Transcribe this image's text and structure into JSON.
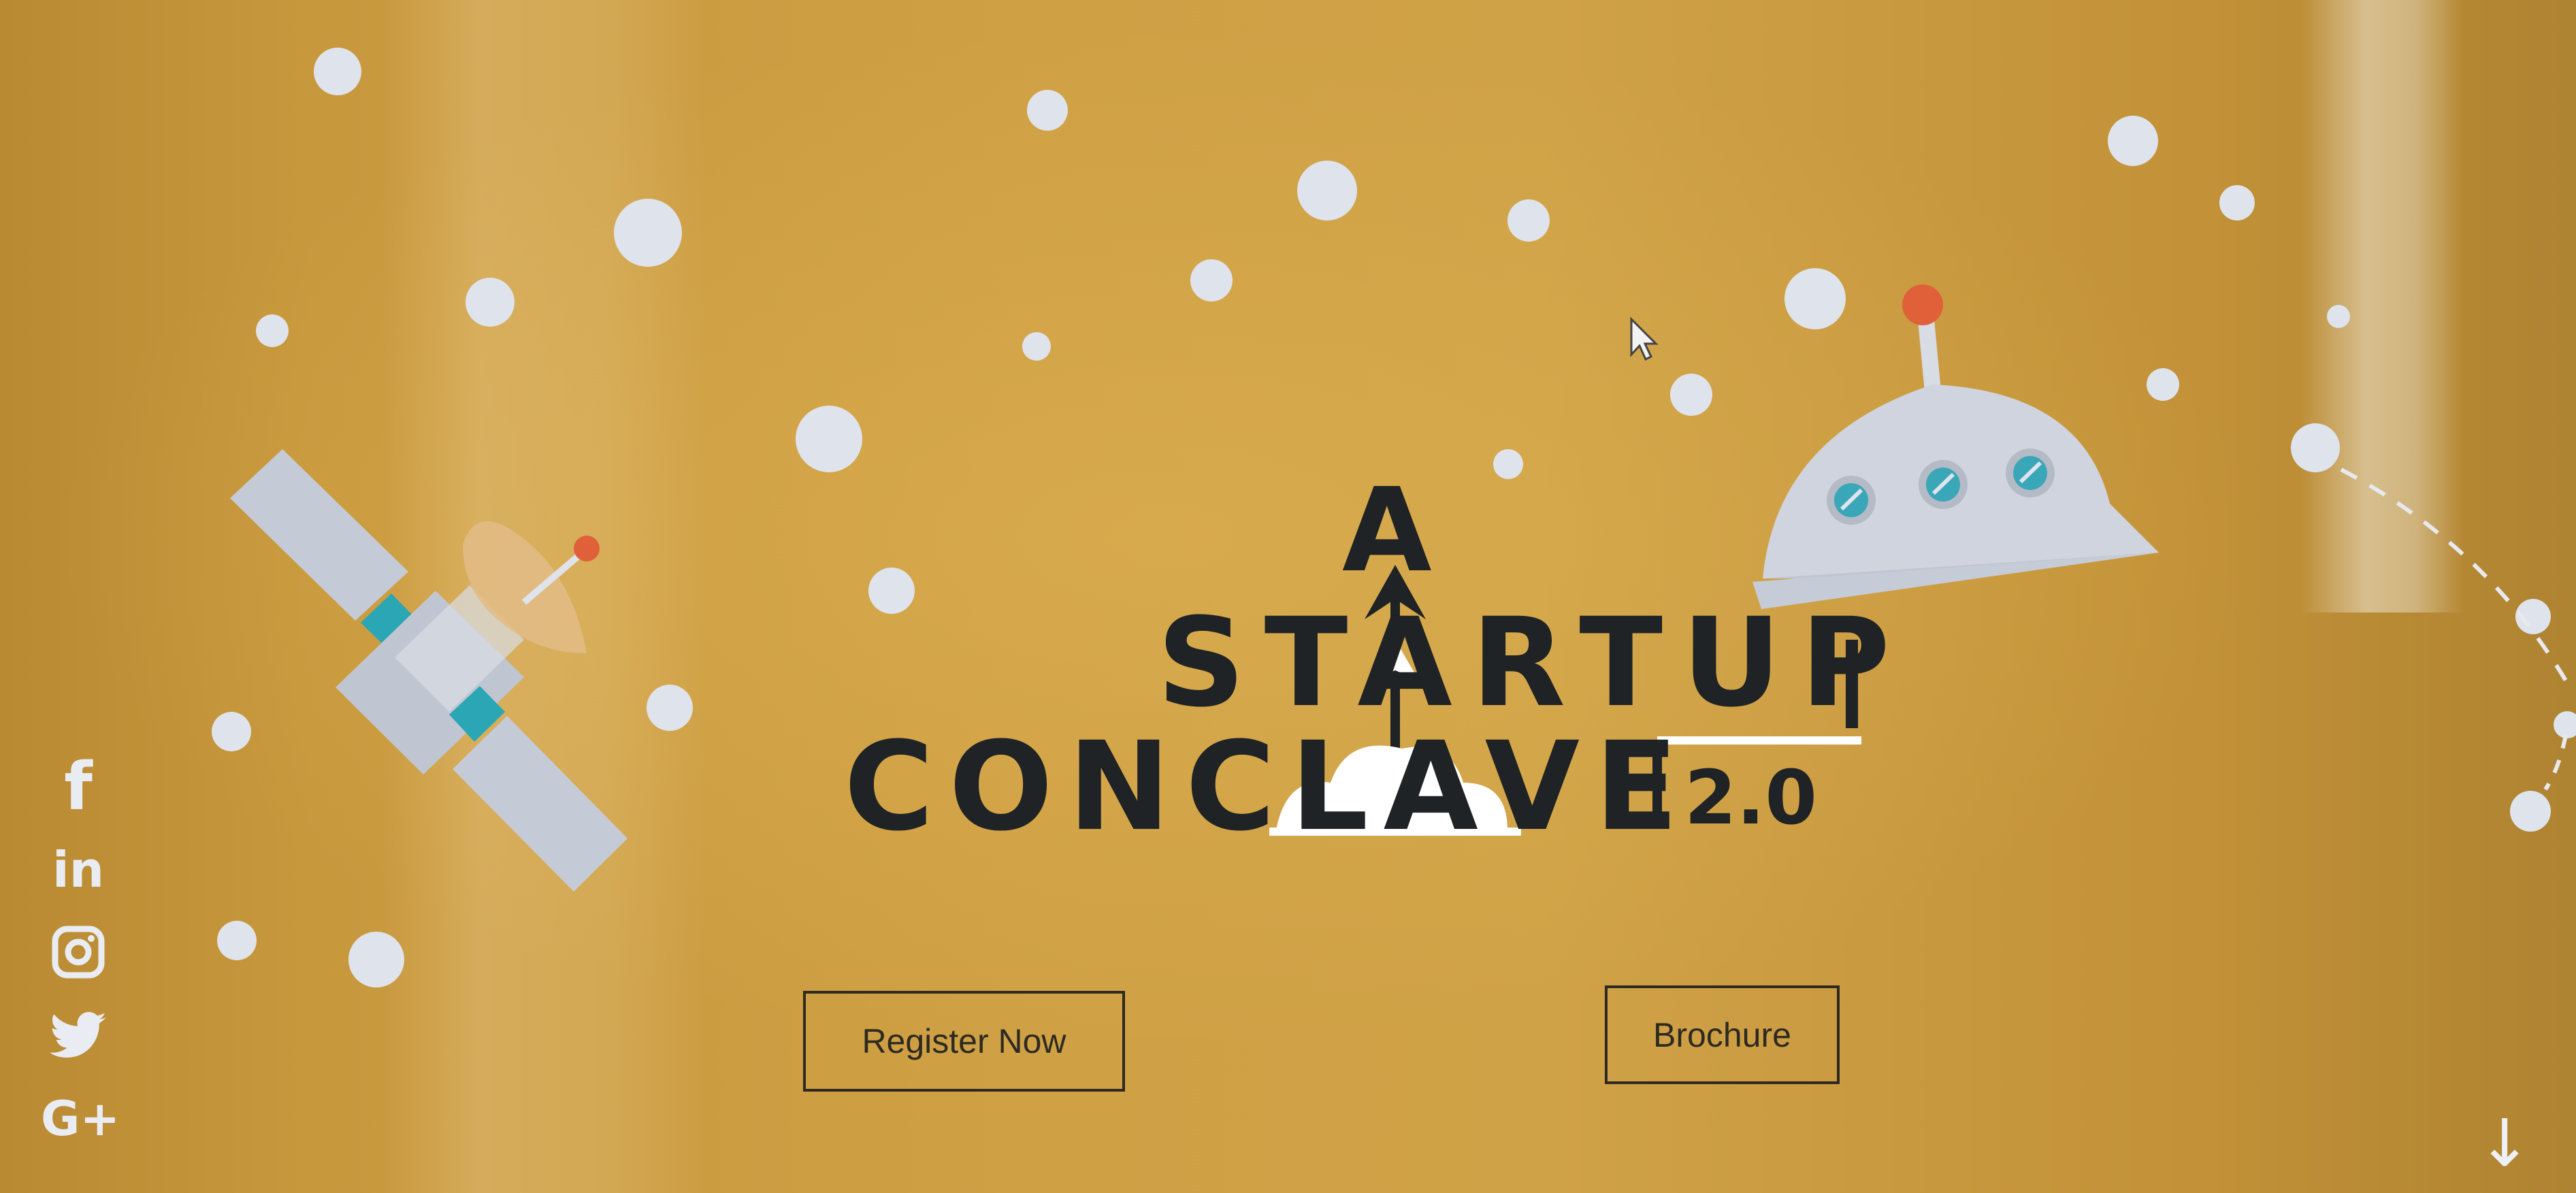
{
  "logo": {
    "line1": "A",
    "line2": "STARTUP",
    "line3": "CONCLAVE",
    "version": "2.0"
  },
  "buttons": {
    "register_label": "Register Now",
    "brochure_label": "Brochure"
  },
  "social": [
    {
      "name": "facebook",
      "glyph": "f"
    },
    {
      "name": "linkedin",
      "glyph": "in"
    },
    {
      "name": "instagram",
      "glyph": "instagram"
    },
    {
      "name": "twitter",
      "glyph": "twitter"
    },
    {
      "name": "google-plus",
      "glyph": "G+"
    }
  ],
  "scroll": {
    "glyph": "↓"
  },
  "colors": {
    "background": "#c99a3c",
    "bubble": "#dfe3ec",
    "logo_dark": "#1f2326",
    "logo_light": "#ffffff",
    "rocket_dot": "#e0603a",
    "porthole": "#3aa7b8",
    "button_border": "#2d2a22"
  }
}
